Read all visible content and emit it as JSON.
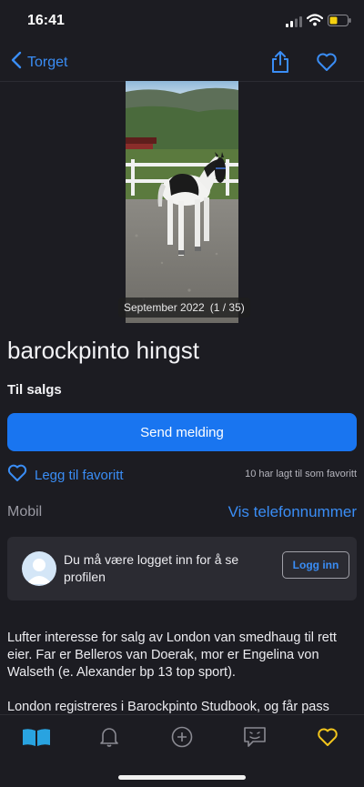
{
  "status_bar": {
    "time": "16:41"
  },
  "nav": {
    "back_label": "Torget"
  },
  "image": {
    "date": "September 2022",
    "counter": "(1 / 35)"
  },
  "listing": {
    "title": "barockpinto hingst",
    "status": "Til salgs",
    "send_label": "Send melding",
    "favorite_label": "Legg til favoritt",
    "favorite_count": "10 har lagt til som favoritt",
    "phone_label": "Mobil",
    "phone_link": "Vis telefonnummer"
  },
  "login_card": {
    "message": "Du må være logget inn for å se profilen",
    "button": "Logg inn"
  },
  "description": {
    "paragraphs": [
      "Lufter interesse for salg av London van smedhaug til rett eier. Far er Belleros van Doerak, mor er Engelina von Walseth (e. Alexander bp 13 top sport).",
      "London registreres i Barockpinto Studbook, og får pass"
    ]
  },
  "colors": {
    "background": "#1c1c22",
    "accent": "#1975f0",
    "link": "#3a8df5",
    "card": "#2b2b32",
    "tab_active_home": "#29a3e0",
    "tab_active_heart": "#f2c51c"
  },
  "tabbar": {
    "items": [
      {
        "icon": "book-open-icon"
      },
      {
        "icon": "bell-icon"
      },
      {
        "icon": "plus-circle-icon"
      },
      {
        "icon": "chat-icon"
      },
      {
        "icon": "heart-icon"
      }
    ]
  }
}
